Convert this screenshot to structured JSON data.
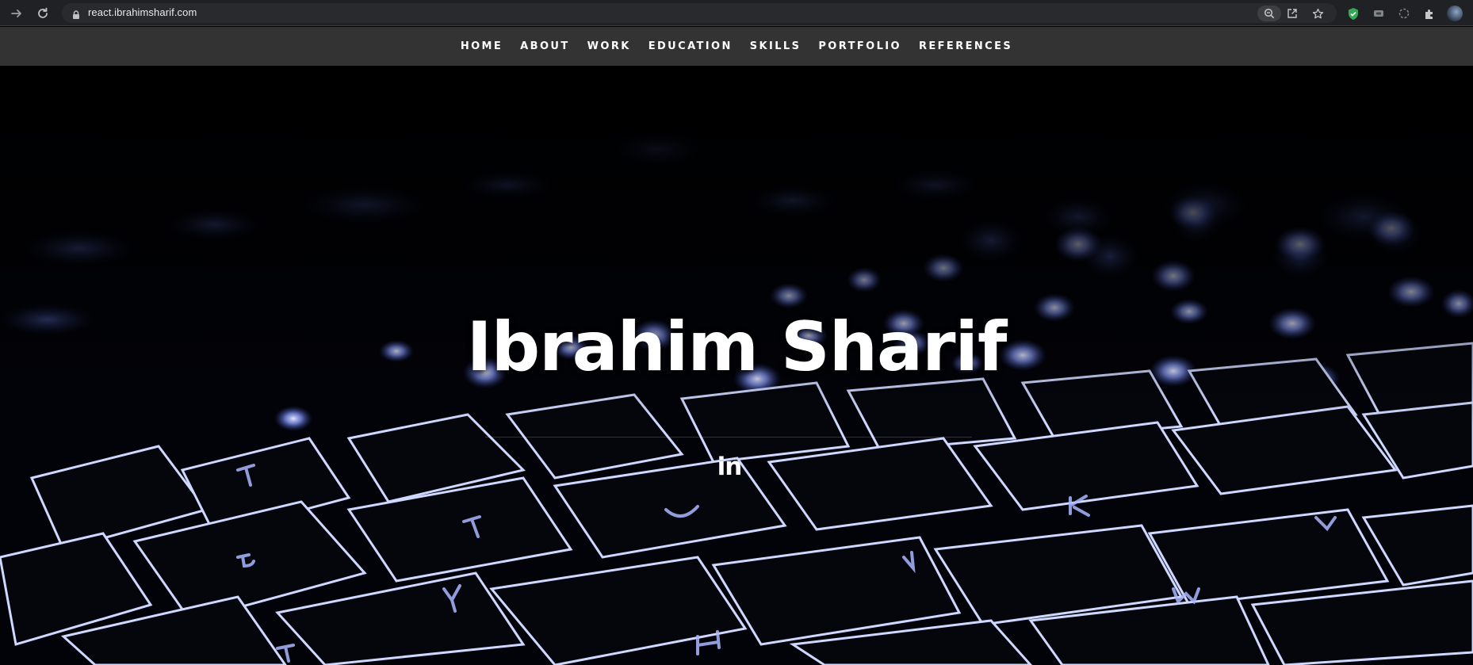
{
  "browser": {
    "url": "react.ibrahimsharif.com",
    "icons": [
      "forward-icon",
      "reload-icon",
      "lock-icon",
      "zoom-icon",
      "share-icon",
      "star-icon",
      "shield-extension-icon",
      "extension-icon",
      "extension-icon",
      "puzzle-icon",
      "profile-avatar"
    ]
  },
  "nav": {
    "items": [
      {
        "label": "HOME"
      },
      {
        "label": "ABOUT"
      },
      {
        "label": "WORK"
      },
      {
        "label": "EDUCATION"
      },
      {
        "label": "SKILLS"
      },
      {
        "label": "PORTFOLIO"
      },
      {
        "label": "REFERENCES"
      }
    ]
  },
  "hero": {
    "title": "Ibrahim Sharif",
    "social": {
      "linkedin_label": "in"
    }
  },
  "colors": {
    "nav_bg": "#333333",
    "chrome_bg": "#202124",
    "key_glow": "#6f86ff"
  }
}
